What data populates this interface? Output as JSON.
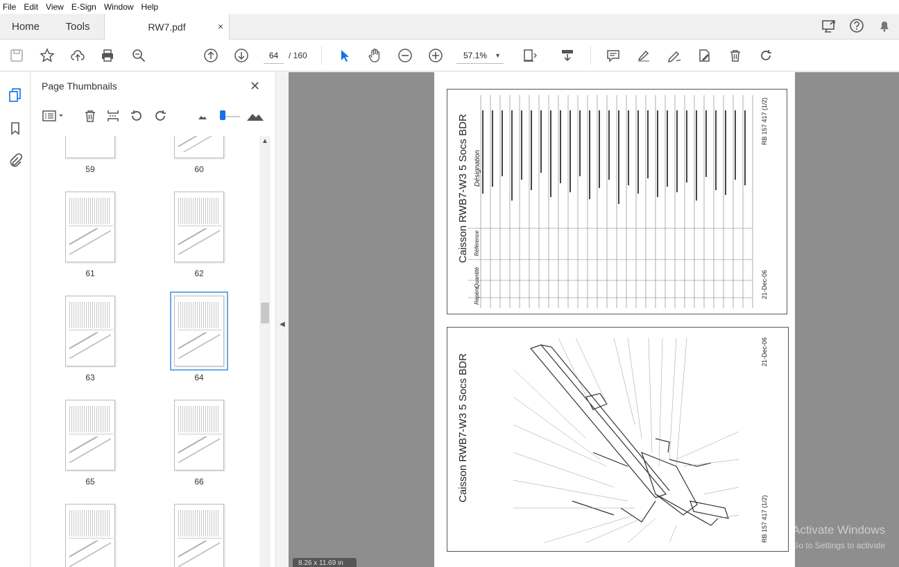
{
  "menu": [
    "File",
    "Edit",
    "View",
    "E-Sign",
    "Window",
    "Help"
  ],
  "tabs": {
    "home": "Home",
    "tools": "Tools",
    "document": "RW7.pdf",
    "close_glyph": "×"
  },
  "toolbar": {
    "current_page": "64",
    "total_pages": "/ 160",
    "zoom": "57.1%"
  },
  "panel": {
    "title": "Page Thumbnails",
    "close_glyph": "✕",
    "thumbnails": [
      {
        "page": "59"
      },
      {
        "page": "60"
      },
      {
        "page": "61"
      },
      {
        "page": "62"
      },
      {
        "page": "63"
      },
      {
        "page": "64",
        "selected": true
      },
      {
        "page": "65"
      },
      {
        "page": "66"
      }
    ]
  },
  "document": {
    "table_title": "Caisson  RWB7-W3  5 Socs    BDR",
    "designation": "Désignation",
    "col_repere": "Repère",
    "col_quantite": "Quantité",
    "col_reference": "Référence",
    "ref_code": "RB 157 417 (1/2)",
    "date": "21-Dec-06",
    "diagram_title": "Caisson  RWB7-W3  5 Socs    BDR",
    "diagram_ref": "RB 157 417 (1/2)",
    "diagram_date": "21-Dec-06",
    "page_size": "8.26 x 11.69 in"
  },
  "watermark": {
    "line1": "Activate Windows",
    "line2": "Go to Settings to activate"
  }
}
